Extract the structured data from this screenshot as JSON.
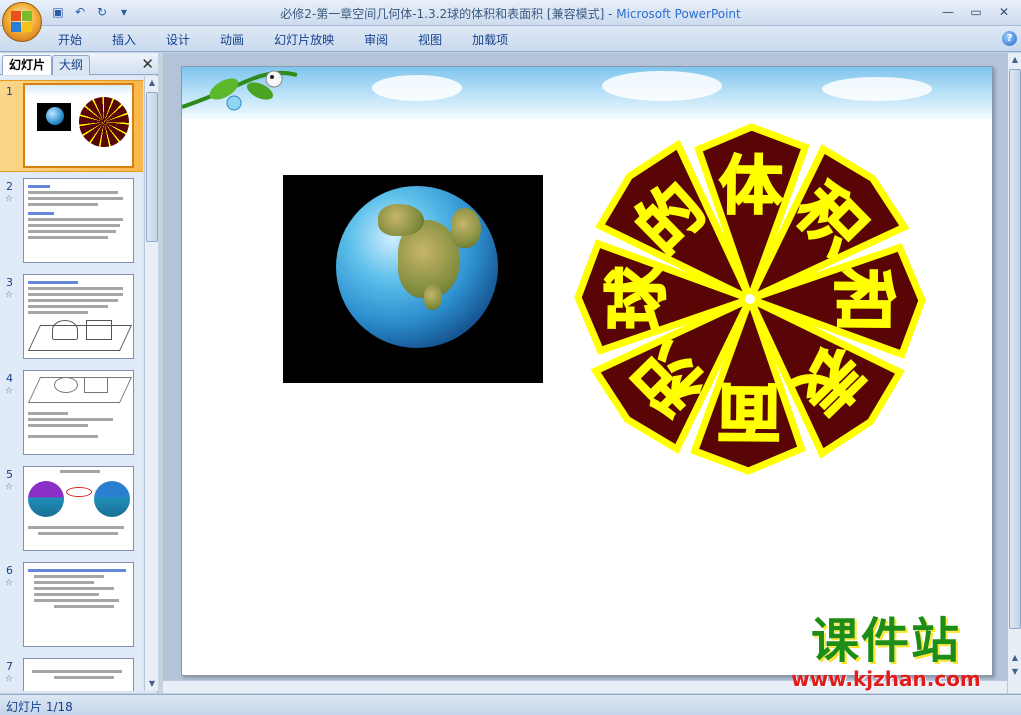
{
  "window": {
    "title": "必修2-第一章空间几何体-1.3.2球的体积和表面积 [兼容模式]",
    "separator": " - ",
    "app_name": "Microsoft PowerPoint"
  },
  "ribbon": {
    "tabs": [
      "开始",
      "插入",
      "设计",
      "动画",
      "幻灯片放映",
      "审阅",
      "视图",
      "加载项"
    ]
  },
  "left_panel": {
    "tab_slides": "幻灯片",
    "tab_outline": "大纲",
    "slide_numbers": [
      "1",
      "2",
      "3",
      "4",
      "5",
      "6",
      "7"
    ],
    "selected_slide": 1
  },
  "slide": {
    "title_petals": [
      "球",
      "的",
      "体",
      "积",
      "和",
      "表",
      "面",
      "积"
    ]
  },
  "watermark": {
    "cn": "课件站",
    "url": "www.kjzhan.com"
  },
  "status": {
    "slide_indicator": "幻灯片 1/18"
  },
  "colors": {
    "petal_fill": "#5a0505",
    "petal_stroke": "#ffff00",
    "selected_thumb": "#f8b74b"
  },
  "icons": [
    "office-button-icon",
    "save-icon",
    "undo-icon",
    "redo-icon",
    "customize-qat-icon",
    "minimize-icon",
    "maximize-icon",
    "close-icon",
    "help-icon"
  ]
}
